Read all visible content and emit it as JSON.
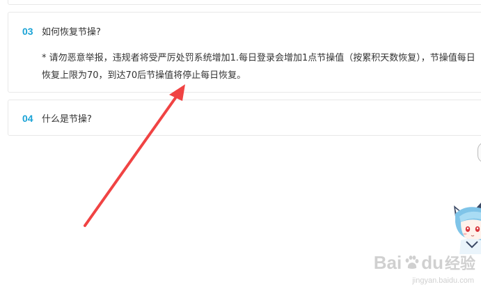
{
  "steps": [
    {
      "number": "03",
      "title": "如何恢复节操?",
      "body": "* 请勿恶意举报，违规者将受严厉处罚系统增加1.每日登录会增加1点节操值（按累积天数恢复），节操值每日恢复上限为70，到达70后节操值将停止每日恢复。"
    },
    {
      "number": "04",
      "title": "什么是节操?"
    }
  ],
  "watermark": {
    "bai": "Bai",
    "du": "du",
    "jingyan": "经验",
    "url": "jingyan.baidu.com"
  },
  "colors": {
    "step_number": "#1aa3d6",
    "arrow": "#f04343",
    "card_border": "#e8e8e8"
  },
  "icons": {
    "annotation_arrow": "red-arrow-icon",
    "mascot": "mascot-icon",
    "watermark_logo": "baidu-paw-icon"
  }
}
